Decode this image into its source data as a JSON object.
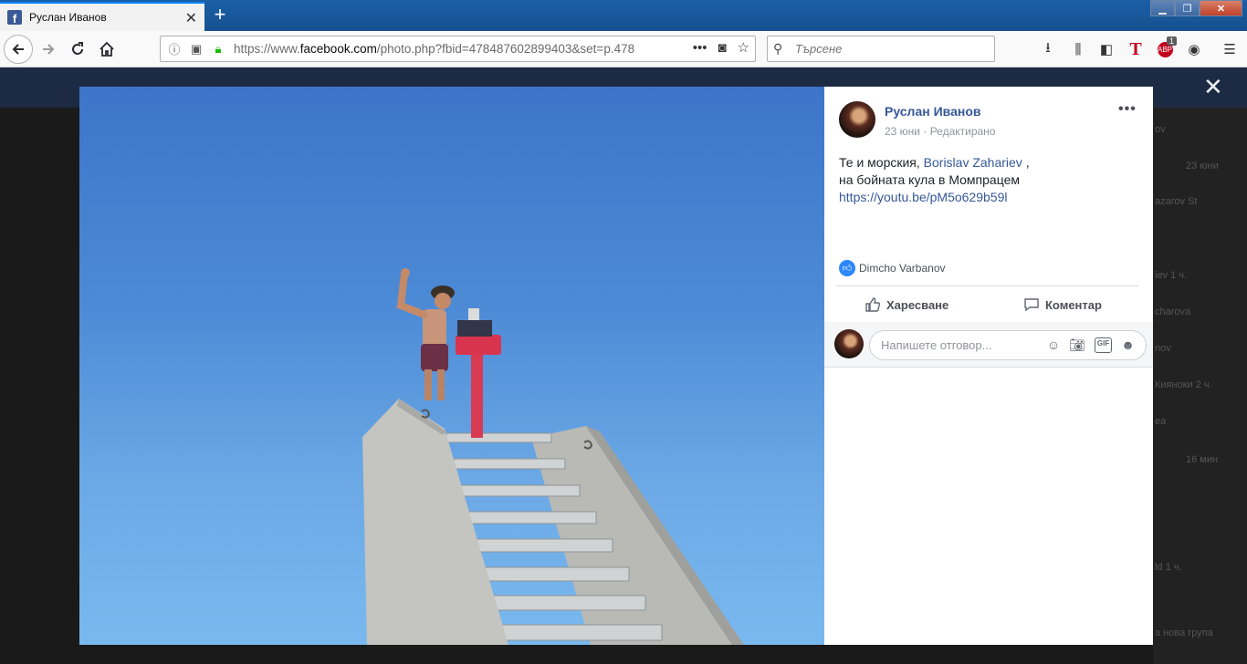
{
  "browser": {
    "tab_title": "Руслан Иванов",
    "url_prefix": "https://www.",
    "url_domain": "facebook.com",
    "url_rest": "/photo.php?fbid=478487602899403&set=p.478",
    "search_placeholder": "Търсене",
    "new_tab": "+",
    "page_actions": "•••",
    "addon_badge": "1"
  },
  "post": {
    "author": "Руслан Иванов",
    "date": "23 юни",
    "separator": " · ",
    "edited": "Редактирано",
    "more": "•••",
    "text_line1_before": "Те и морския, ",
    "tagged_person": "Borislav Zahariev",
    "text_line1_after": " ,",
    "text_line2": "на бойната кула в Момпрацем",
    "link": "https://youtu.be/pM5o629b59l",
    "liked_by": "Dimcho Varbanov"
  },
  "actions": {
    "like": "Харесване",
    "comment": "Коментар"
  },
  "comment_box": {
    "placeholder": "Напишете отговор..."
  },
  "background_sidebar": [
    {
      "text": "ov"
    },
    {
      "text": "23 юни"
    },
    {
      "text": "azarov St"
    },
    {
      "text": "iev     1 ч."
    },
    {
      "text": "charova"
    },
    {
      "text": "nov"
    },
    {
      "text": "Кияноки  2 ч."
    },
    {
      "text": "ea"
    },
    {
      "text": "16 мин"
    },
    {
      "text": "ld     1 ч."
    },
    {
      "text": "а нова група"
    }
  ],
  "colors": {
    "link": "#365899",
    "facebook_blue": "#3b5998",
    "sky": "#4d8bd6"
  }
}
